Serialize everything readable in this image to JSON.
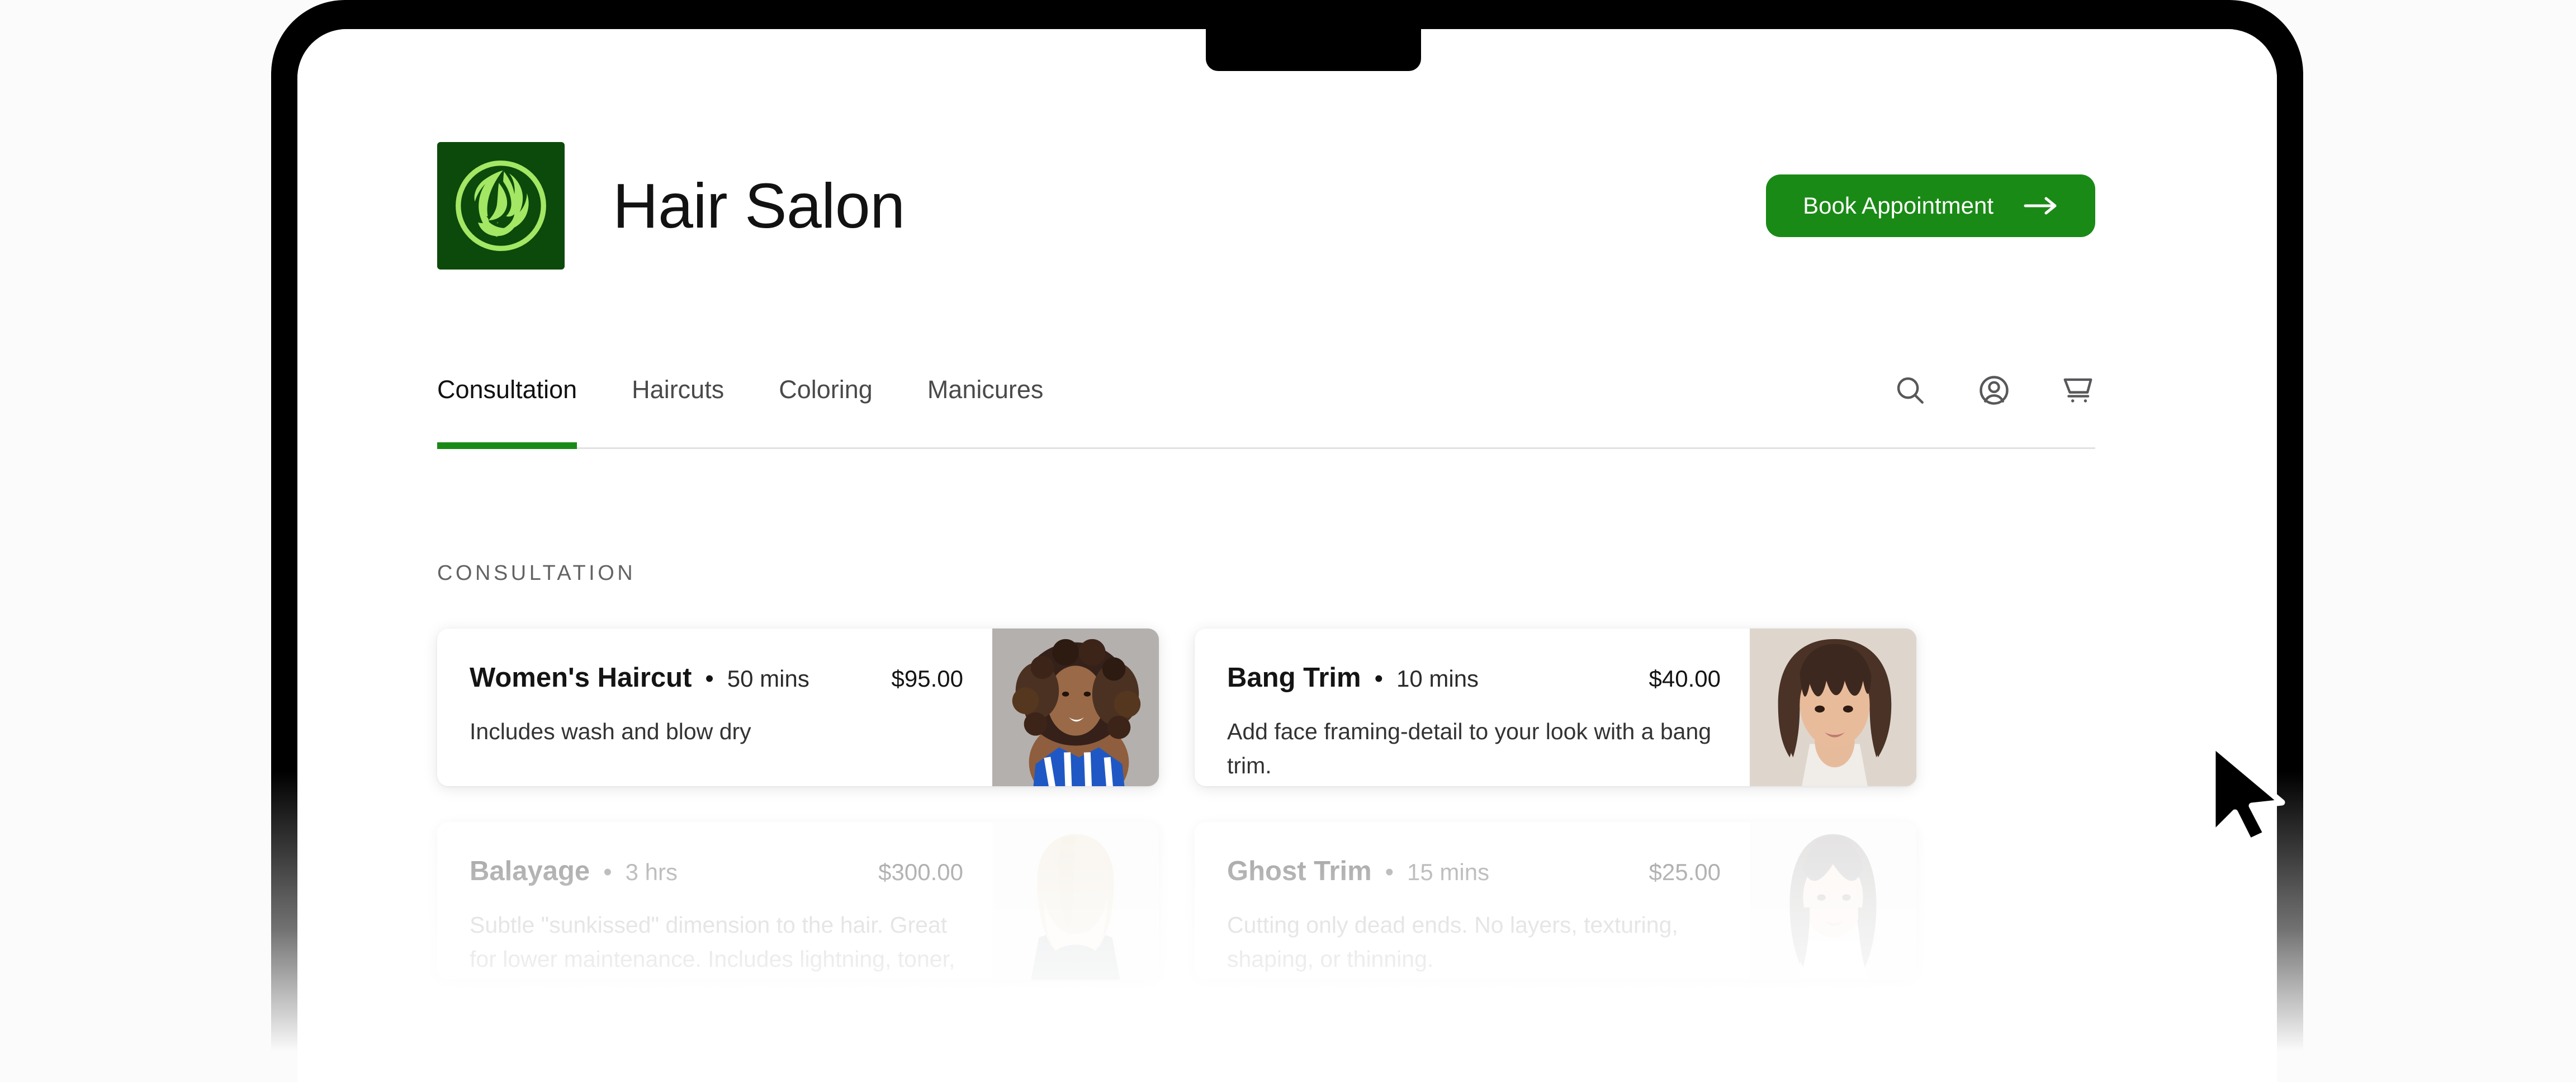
{
  "brand": {
    "name": "Hair Salon",
    "logo_icon": "woman-profile-hair-logo",
    "logo_bg": "#0b4a0b",
    "logo_fg": "#a4e764"
  },
  "header": {
    "cta_label": "Book Appointment",
    "cta_icon": "arrow-right-icon",
    "cta_color": "#1a8a16"
  },
  "nav": {
    "tabs": [
      {
        "label": "Consultation",
        "active": true
      },
      {
        "label": "Haircuts",
        "active": false
      },
      {
        "label": "Coloring",
        "active": false
      },
      {
        "label": "Manicures",
        "active": false
      }
    ],
    "active_indicator_color": "#1a8a16",
    "icons": [
      {
        "name": "search-icon"
      },
      {
        "name": "account-icon"
      },
      {
        "name": "cart-icon"
      }
    ]
  },
  "main": {
    "section_label": "CONSULTATION",
    "services": [
      {
        "title": "Women's Haircut",
        "separator": "•",
        "duration": "50 mins",
        "price": "$95.00",
        "description": "Includes wash and blow dry",
        "image_alt": "woman-with-curly-hair-photo",
        "faded": false
      },
      {
        "title": "Bang Trim",
        "separator": "•",
        "duration": "10 mins",
        "price": "$40.00",
        "description": "Add face framing-detail to your look with a bang trim.",
        "image_alt": "woman-with-bob-and-bangs-photo",
        "faded": false
      },
      {
        "title": "Balayage",
        "separator": "•",
        "duration": "3 hrs",
        "price": "$300.00",
        "description": "Subtle \"sunkissed\" dimension to the hair. Great for lower maintenance. Includes lightning, toner, and...",
        "image_alt": "blonde-balayage-hair-photo",
        "faded": true
      },
      {
        "title": "Ghost Trim",
        "separator": "•",
        "duration": "15 mins",
        "price": "$25.00",
        "description": "Cutting only dead ends. No layers, texturing, shaping, or thinning.",
        "image_alt": "woman-with-long-dark-hair-photo",
        "faded": true
      }
    ]
  },
  "cursor": {
    "icon": "mouse-pointer-arrow"
  }
}
